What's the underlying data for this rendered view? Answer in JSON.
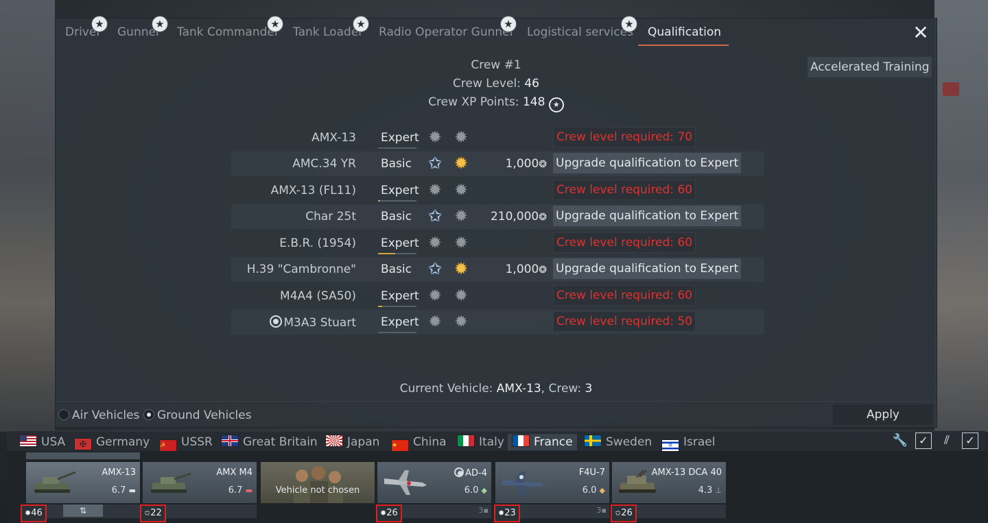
{
  "tabs": [
    {
      "label": "Driver",
      "has_star": true
    },
    {
      "label": "Gunner",
      "has_star": true
    },
    {
      "label": "Tank Commander",
      "has_star": true
    },
    {
      "label": "Tank Loader",
      "has_star": true
    },
    {
      "label": "Radio Operator Gunner",
      "has_star": true
    },
    {
      "label": "Logistical services",
      "has_star": true
    },
    {
      "label": "Qualification",
      "has_star": false,
      "active": true
    }
  ],
  "accelerated_training_label": "Accelerated Training",
  "crew": {
    "title": "Crew #1",
    "level_label": "Crew Level:",
    "level_value": "46",
    "xp_label": "Crew XP Points:",
    "xp_value": "148"
  },
  "qualifications": [
    {
      "vehicle": "AMX-13",
      "qualification": "Expert",
      "progress": 0,
      "cost": "",
      "action": "Crew level required: 70",
      "action_type": "requirement"
    },
    {
      "vehicle": "AMC.34 YR",
      "qualification": "Basic",
      "progress": 0,
      "cost": "1,000",
      "action": "Upgrade qualification to Expert",
      "action_type": "button"
    },
    {
      "vehicle": "AMX-13 (FL11)",
      "qualification": "Expert",
      "progress": 0.05,
      "cost": "",
      "action": "Crew level required: 60",
      "action_type": "requirement"
    },
    {
      "vehicle": "Char 25t",
      "qualification": "Basic",
      "progress": 0,
      "cost": "210,000",
      "action": "Upgrade qualification to Expert",
      "action_type": "button"
    },
    {
      "vehicle": "E.B.R. (1954)",
      "qualification": "Expert",
      "progress": 0.45,
      "cost": "",
      "action": "Crew level required: 60",
      "action_type": "requirement"
    },
    {
      "vehicle": "H.39 \"Cambronne\"",
      "qualification": "Basic",
      "progress": 0,
      "cost": "1,000",
      "action": "Upgrade qualification to Expert",
      "action_type": "button"
    },
    {
      "vehicle": "M4A4 (SA50)",
      "qualification": "Expert",
      "progress": 0.1,
      "cost": "",
      "action": "Crew level required: 60",
      "action_type": "requirement"
    },
    {
      "vehicle": "M3A3 Stuart",
      "qualification": "Expert",
      "progress": 0,
      "cost": "",
      "action": "Crew level required: 50",
      "action_type": "requirement",
      "premium_mark": true
    }
  ],
  "current_vehicle": {
    "label": "Current Vehicle:",
    "vehicle": "AMX-13",
    "crew_label": ", Crew:",
    "crew": "3"
  },
  "vehicle_filter": {
    "air_label": "Air Vehicles",
    "ground_label": "Ground Vehicles",
    "selected": "ground"
  },
  "apply_label": "Apply",
  "nations": [
    {
      "name": "USA",
      "flag": "usa"
    },
    {
      "name": "Germany",
      "flag": "germany"
    },
    {
      "name": "USSR",
      "flag": "ussr"
    },
    {
      "name": "Great Britain",
      "flag": "gb"
    },
    {
      "name": "Japan",
      "flag": "japan"
    },
    {
      "name": "China",
      "flag": "china"
    },
    {
      "name": "Italy",
      "flag": "italy"
    },
    {
      "name": "France",
      "flag": "france",
      "active": true
    },
    {
      "name": "Sweden",
      "flag": "sweden"
    },
    {
      "name": "Israel",
      "flag": "israel"
    }
  ],
  "slots": [
    {
      "name": "AMX-13",
      "br": "6.7",
      "crew_level": "46",
      "selected": true,
      "icon": "tank"
    },
    {
      "name": "AMX M4",
      "br": "6.7",
      "crew_level": "22",
      "icon": "tank"
    },
    {
      "name": "",
      "br": "",
      "empty_text": "Vehicle not chosen",
      "crew_level": "",
      "icon": "crew"
    },
    {
      "name": "AD-4",
      "br": "6.0",
      "crew_level": "26",
      "count": "3",
      "icon": "plane",
      "premium_mark": true
    },
    {
      "name": "F4U-7",
      "br": "6.0",
      "crew_level": "23",
      "count": "3",
      "icon": "plane"
    },
    {
      "name": "AMX-13 DCA 40",
      "br": "4.3",
      "crew_level": "26",
      "icon": "spaa"
    }
  ]
}
